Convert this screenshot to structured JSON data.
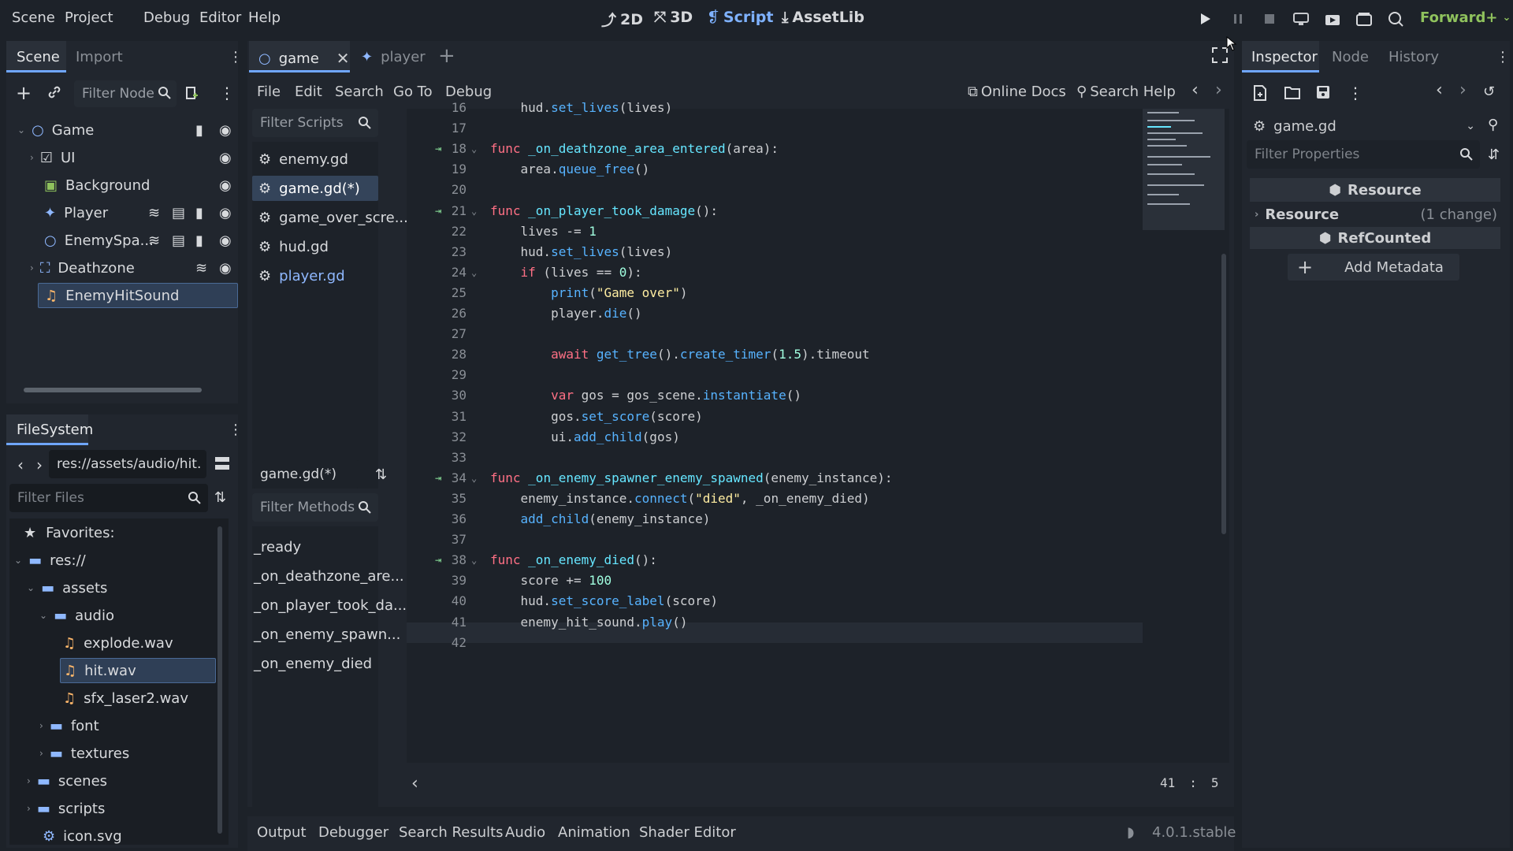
{
  "menu": [
    "Scene",
    "Project",
    "Debug",
    "Editor",
    "Help"
  ],
  "workspaces": {
    "w2d": "2D",
    "w3d": "3D",
    "script": "Script",
    "assetlib": "AssetLib"
  },
  "renderer": "Forward+",
  "scene_dock": {
    "tabs": {
      "scene": "Scene",
      "import": "Import"
    },
    "filter_placeholder": "Filter Node",
    "tree": [
      {
        "label": "Game"
      },
      {
        "label": "UI"
      },
      {
        "label": "Background"
      },
      {
        "label": "Player"
      },
      {
        "label": "EnemySpa..."
      },
      {
        "label": "Deathzone"
      },
      {
        "label": "EnemyHitSound"
      }
    ]
  },
  "filesystem": {
    "title": "FileSystem",
    "path": "res://assets/audio/hit.",
    "filter_placeholder": "Filter Files",
    "items": [
      {
        "label": "Favorites:"
      },
      {
        "label": "res://"
      },
      {
        "label": "assets"
      },
      {
        "label": "audio"
      },
      {
        "label": "explode.wav"
      },
      {
        "label": "hit.wav"
      },
      {
        "label": "sfx_laser2.wav"
      },
      {
        "label": "font"
      },
      {
        "label": "textures"
      },
      {
        "label": "scenes"
      },
      {
        "label": "scripts"
      },
      {
        "label": "icon.svg"
      }
    ]
  },
  "editor_tabs": {
    "game": "game",
    "player": "player"
  },
  "script_menu": {
    "file": "File",
    "edit": "Edit",
    "search": "Search",
    "goto": "Go To",
    "debug": "Debug",
    "online_docs": "Online Docs",
    "search_help": "Search Help"
  },
  "scripts_list": {
    "filter_placeholder": "Filter Scripts",
    "items": [
      "enemy.gd",
      "game.gd(*)",
      "game_over_scre...",
      "hud.gd",
      "player.gd"
    ],
    "current": "game.gd(*)",
    "methods_placeholder": "Filter Methods",
    "methods": [
      "_ready",
      "_on_deathzone_are...",
      "_on_player_took_da...",
      "_on_enemy_spawn...",
      "_on_enemy_died"
    ]
  },
  "code": {
    "lines": [
      {
        "n": "16",
        "text": "    hud.set_lives(lives)"
      },
      {
        "n": "17",
        "text": ""
      },
      {
        "n": "18",
        "text": "func _on_deathzone_area_entered(area):"
      },
      {
        "n": "19",
        "text": "    area.queue_free()"
      },
      {
        "n": "20",
        "text": ""
      },
      {
        "n": "21",
        "text": "func _on_player_took_damage():"
      },
      {
        "n": "22",
        "text": "    lives -= 1"
      },
      {
        "n": "23",
        "text": "    hud.set_lives(lives)"
      },
      {
        "n": "24",
        "text": "    if (lives == 0):"
      },
      {
        "n": "25",
        "text": "        print(\"Game over\")"
      },
      {
        "n": "26",
        "text": "        player.die()"
      },
      {
        "n": "27",
        "text": ""
      },
      {
        "n": "28",
        "text": "        await get_tree().create_timer(1.5).timeout"
      },
      {
        "n": "29",
        "text": ""
      },
      {
        "n": "30",
        "text": "        var gos = gos_scene.instantiate()"
      },
      {
        "n": "31",
        "text": "        gos.set_score(score)"
      },
      {
        "n": "32",
        "text": "        ui.add_child(gos)"
      },
      {
        "n": "33",
        "text": ""
      },
      {
        "n": "34",
        "text": "func _on_enemy_spawner_enemy_spawned(enemy_instance):"
      },
      {
        "n": "35",
        "text": "    enemy_instance.connect(\"died\", _on_enemy_died)"
      },
      {
        "n": "36",
        "text": "    add_child(enemy_instance)"
      },
      {
        "n": "37",
        "text": ""
      },
      {
        "n": "38",
        "text": "func _on_enemy_died():"
      },
      {
        "n": "39",
        "text": "    score += 100"
      },
      {
        "n": "40",
        "text": "    hud.set_score_label(score)"
      },
      {
        "n": "41",
        "text": "    enemy_hit_sound.play()"
      },
      {
        "n": "42",
        "text": ""
      }
    ],
    "cursor_line": "41",
    "cursor_col": "5"
  },
  "bottom_tabs": [
    "Output",
    "Debugger",
    "Search Results",
    "Audio",
    "Animation",
    "Shader Editor"
  ],
  "version": "4.0.1.stable",
  "inspector": {
    "tabs": {
      "inspector": "Inspector",
      "node": "Node",
      "history": "History"
    },
    "object": "game.gd",
    "filter_placeholder": "Filter Properties",
    "section_resource": "Resource",
    "resource_label": "Resource",
    "resource_change": "(1 change)",
    "section_refcounted": "RefCounted",
    "add_metadata": "Add Metadata"
  },
  "colors": {
    "accent": "#6fa6ff",
    "keyword": "#ff7085",
    "function": "#57b3ff",
    "string": "#ffeda1",
    "number": "#a1ffe0",
    "renderer": "#8fc25d"
  }
}
